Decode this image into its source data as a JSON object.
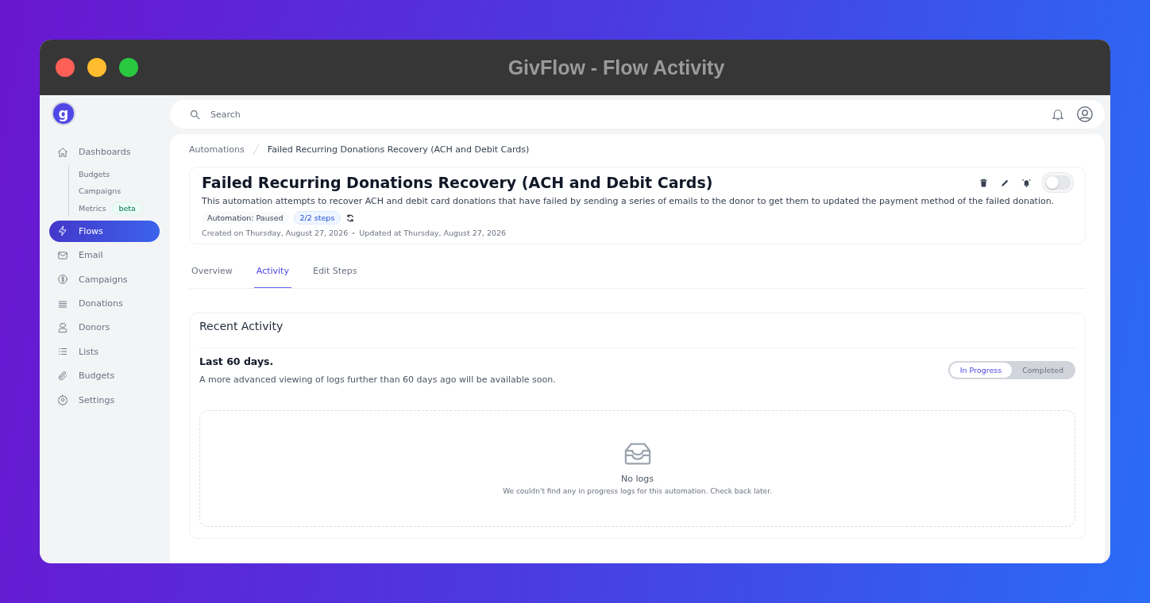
{
  "window": {
    "title": "GivFlow - Flow Activity"
  },
  "sidebar": {
    "logo": "g",
    "items": [
      {
        "label": "Dashboards",
        "selected": false,
        "children": [
          {
            "label": "Budgets"
          },
          {
            "label": "Campaigns"
          },
          {
            "label": "Metrics",
            "badge": "beta"
          }
        ]
      },
      {
        "label": "Flows",
        "selected": true
      },
      {
        "label": "Email",
        "selected": false
      },
      {
        "label": "Campaigns",
        "selected": false
      },
      {
        "label": "Donations",
        "selected": false
      },
      {
        "label": "Donors",
        "selected": false
      },
      {
        "label": "Lists",
        "selected": false
      },
      {
        "label": "Budgets",
        "selected": false
      },
      {
        "label": "Settings",
        "selected": false
      }
    ]
  },
  "search": {
    "placeholder": "Search"
  },
  "breadcrumb": [
    "Automations",
    "Failed Recurring Donations Recovery (ACH and Debit Cards)"
  ],
  "automation": {
    "title": "Failed Recurring Donations Recovery (ACH and Debit Cards)",
    "description": "This automation attempts to recover ACH and debit card donations that have failed by sending a series of emails to the donor to get them to updated the payment method of the failed donation.",
    "status": "Automation: Paused",
    "steps": "2/2 steps",
    "created": "Created on Thursday, August 27, 2026",
    "updated": "Updated at Thursday, August 27, 2026",
    "enabled": false
  },
  "tabs": [
    {
      "label": "Overview",
      "selected": false
    },
    {
      "label": "Activity",
      "selected": true
    },
    {
      "label": "Edit Steps",
      "selected": false
    }
  ],
  "activity": {
    "title": "Recent Activity",
    "period": "Last 60 days.",
    "note": "A more advanced viewing of logs further than 60 days ago will be available soon.",
    "filters": [
      {
        "label": "In Progress",
        "selected": true
      },
      {
        "label": "Completed",
        "selected": false
      }
    ],
    "empty": {
      "title": "No logs",
      "text": "We couldn't find any in progress logs for this automation. Check back later."
    }
  }
}
